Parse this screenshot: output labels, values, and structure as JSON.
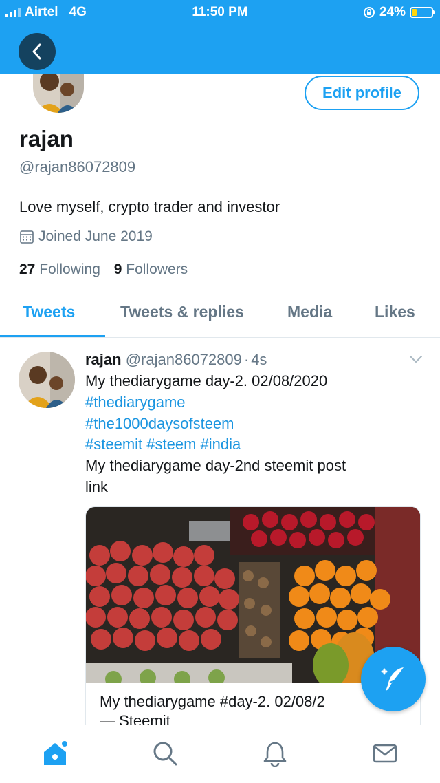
{
  "status_bar": {
    "carrier": "Airtel",
    "network": "4G",
    "time": "11:50 PM",
    "battery_percent": "24%",
    "battery_level": 0.24
  },
  "nav": {
    "back_icon": "chevron-left-icon"
  },
  "profile": {
    "edit_label": "Edit profile",
    "name": "rajan",
    "handle": "@rajan86072809",
    "bio": "Love myself, crypto trader and investor",
    "joined": "Joined June 2019",
    "following_count": "27",
    "following_label": "Following",
    "followers_count": "9",
    "followers_label": "Followers"
  },
  "tabs": [
    {
      "label": "Tweets",
      "active": true
    },
    {
      "label": "Tweets & replies",
      "active": false
    },
    {
      "label": "Media",
      "active": false
    },
    {
      "label": "Likes",
      "active": false
    }
  ],
  "tweet": {
    "author_name": "rajan",
    "author_handle": "@rajan86072809",
    "separator": "·",
    "age": "4s",
    "lines": [
      "My thediarygame day-2. 02/08/2020",
      "#thediarygame",
      "#the1000daysofsteem",
      "#steemit #steem #india",
      "My thediarygame day-2nd steemit post",
      "link"
    ],
    "card_title": "My thediarygame #day-2. 02/08/2",
    "card_subtitle": "— Steemit"
  },
  "colors": {
    "brand": "#1da1f2",
    "link": "#1b95e0",
    "secondary_text": "#657786"
  },
  "bottom_tabs": [
    "home-icon",
    "search-icon",
    "notifications-icon",
    "messages-icon"
  ]
}
